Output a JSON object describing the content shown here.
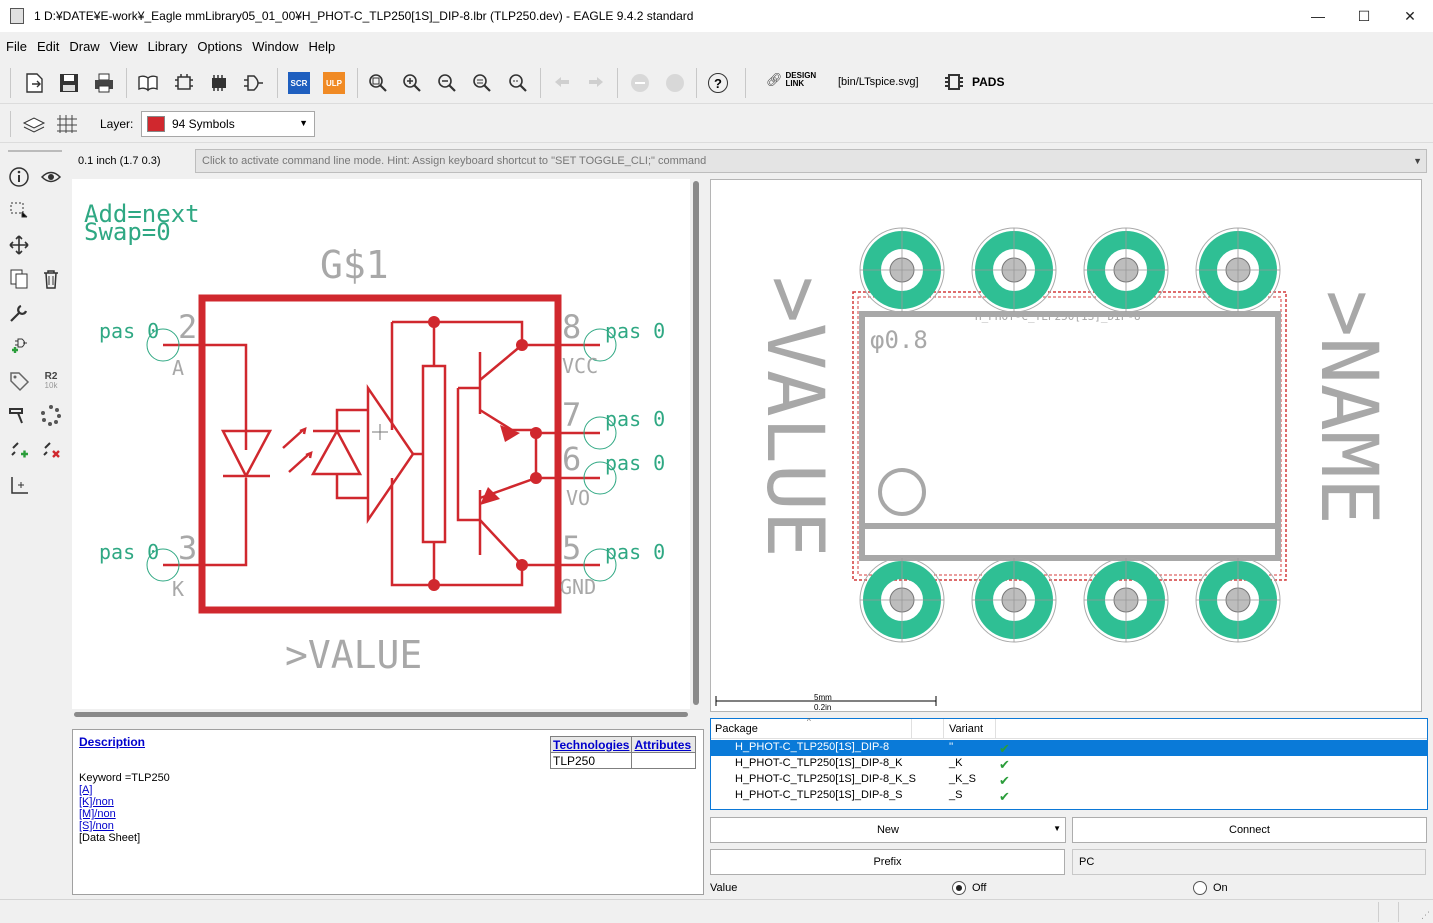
{
  "window": {
    "title": "1 D:¥DATE¥E-work¥_Eagle mmLibrary05_01_00¥H_PHOT-C_TLP250[1S]_DIP-8.lbr (TLP250.dev) - EAGLE 9.4.2 standard",
    "minimize": "—",
    "maximize": "☐",
    "close": "✕"
  },
  "menu": [
    "File",
    "Edit",
    "Draw",
    "View",
    "Library",
    "Options",
    "Window",
    "Help"
  ],
  "toolbar": {
    "scr": "SCR",
    "ulp": "ULP",
    "design_link_1": "DESIGN",
    "design_link_2": "LINK",
    "script_path": "[bin/LTspice.svg]",
    "pads": "PADS",
    "help": "?"
  },
  "layerbar": {
    "label": "Layer:",
    "selected": "94 Symbols",
    "color": "#d0282e"
  },
  "leftbar": {
    "r2": "R2",
    "r2_sub": "10k"
  },
  "coord": "0.1 inch (1.7 0.3)",
  "command_hint": "Click to activate command line mode. Hint: Assign keyboard shortcut to \"SET TOGGLE_CLI;\" command",
  "symbol": {
    "add": "Add=next",
    "swap": "Swap=0",
    "gate": "G$1",
    "value": ">VALUE",
    "pin_labels": {
      "p2": "pas 0",
      "p3": "pas 0",
      "p8": "pas 0",
      "p7": "pas 0",
      "p6": "pas 0",
      "p5": "pas 0"
    },
    "pin_numbers": {
      "n2": "2",
      "n3": "3",
      "n8": "8",
      "n7": "7",
      "n6": "6",
      "n5": "5"
    },
    "pin_names": {
      "a": "A",
      "k": "K",
      "vcc": "VCC",
      "vo": "VO",
      "gnd": "GND"
    },
    "colors": {
      "symbol": "#d0282e",
      "pin_text": "#2fa883",
      "text": "#a8a8a8"
    }
  },
  "package": {
    "value": ">VALUE",
    "name": ">NAME",
    "pkg_name": "H_PHOT-C_TLP250[1S]_DIP-8",
    "drill": "φ0.8",
    "scale_mm": "5mm",
    "scale_in": "0.2in",
    "pad_color": "#2fbf94"
  },
  "description": {
    "title": "Description",
    "tech_header": "Technologies",
    "attr_header": "Attributes",
    "tech_value": "TLP250",
    "keyword": "Keyword =TLP250",
    "links": [
      "[A]",
      "[K]/non",
      "[M]/non",
      "[S]/non"
    ],
    "datasheet": "[Data Sheet]"
  },
  "variants": {
    "col_package": "Package",
    "col_variant": "Variant",
    "rows": [
      {
        "package": "H_PHOT-C_TLP250[1S]_DIP-8",
        "variant": "''",
        "selected": true
      },
      {
        "package": "H_PHOT-C_TLP250[1S]_DIP-8_K",
        "variant": "_K",
        "selected": false
      },
      {
        "package": "H_PHOT-C_TLP250[1S]_DIP-8_K_S",
        "variant": "_K_S",
        "selected": false
      },
      {
        "package": "H_PHOT-C_TLP250[1S]_DIP-8_S",
        "variant": "_S",
        "selected": false
      }
    ]
  },
  "buttons": {
    "new": "New",
    "connect": "Connect",
    "prefix": "Prefix",
    "prefix_value": "PC"
  },
  "value_row": {
    "label": "Value",
    "off": "Off",
    "on": "On",
    "selected": "Off"
  }
}
